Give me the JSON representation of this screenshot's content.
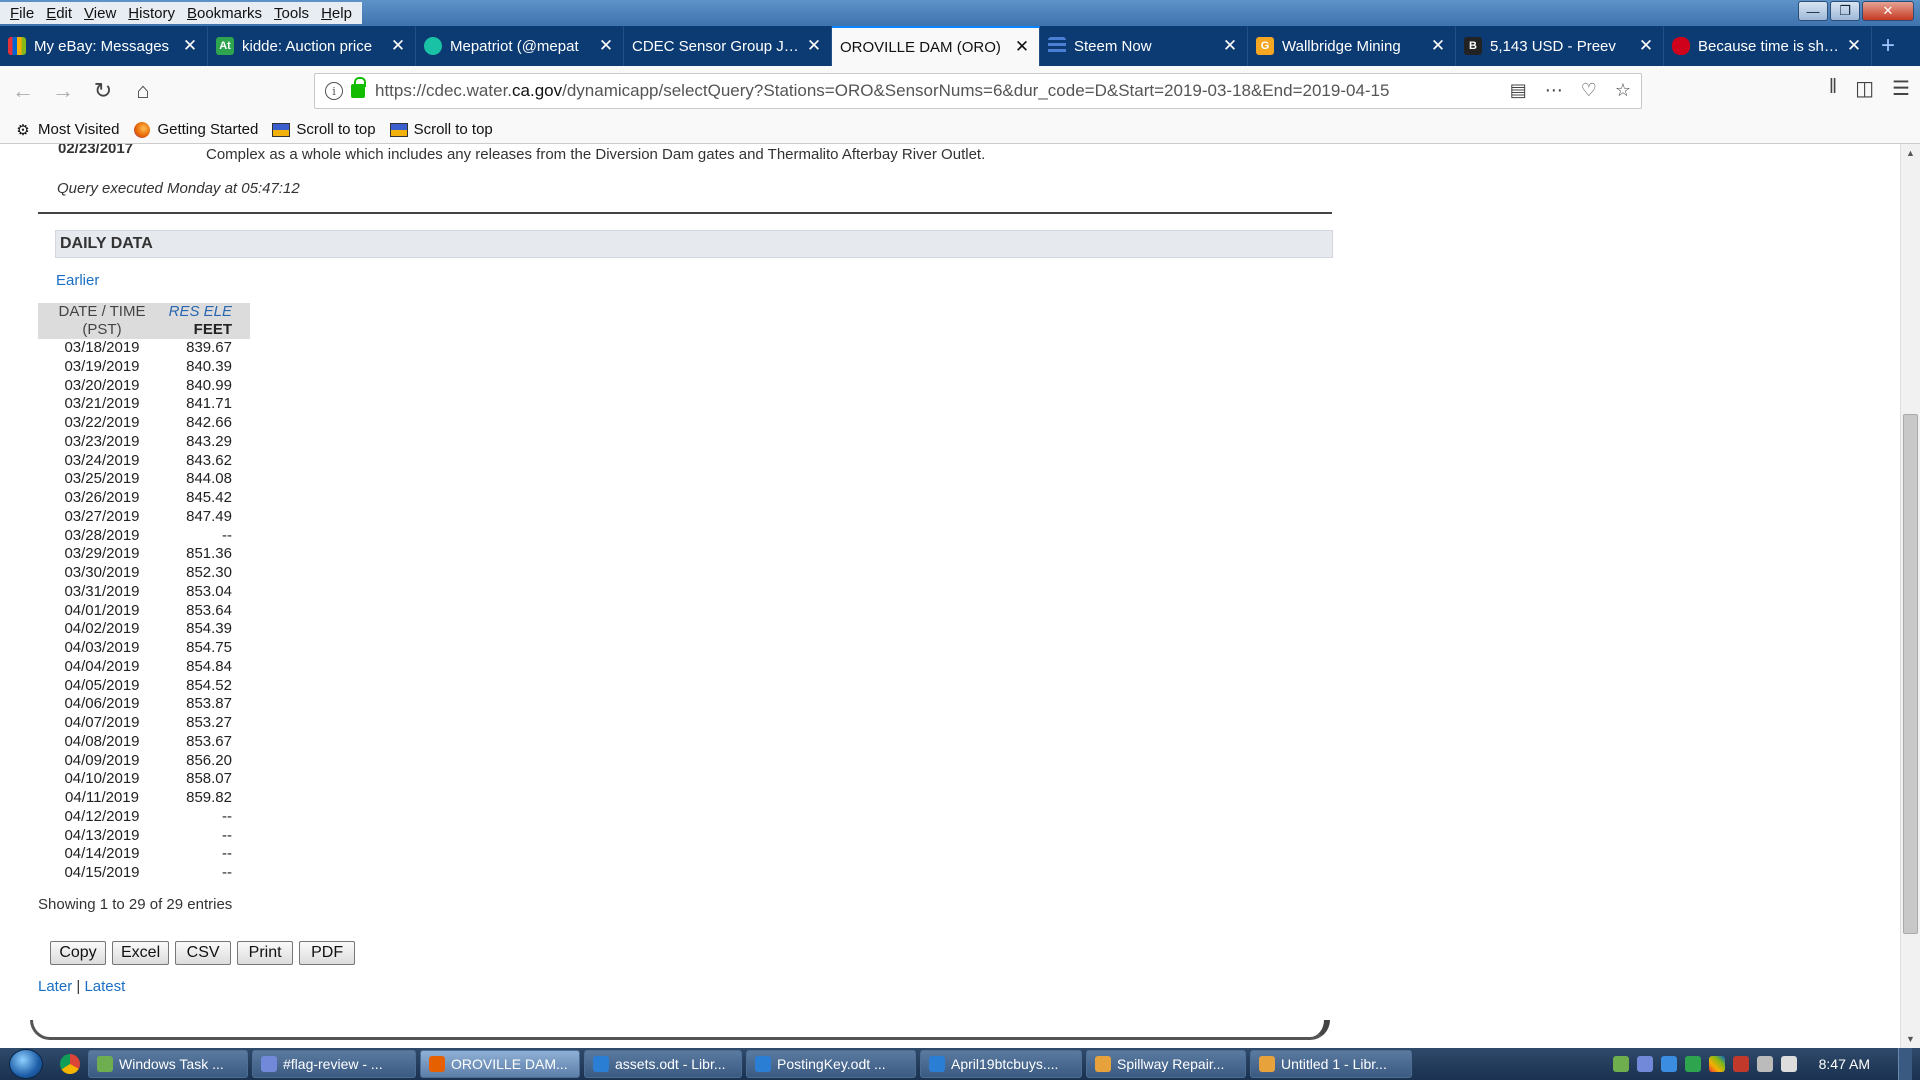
{
  "menubar": {
    "items": [
      "File",
      "Edit",
      "View",
      "History",
      "Bookmarks",
      "Tools",
      "Help"
    ]
  },
  "tabs": [
    {
      "title": "My eBay: Messages",
      "icon": "ebay-icon",
      "color": "#e53238",
      "active": false
    },
    {
      "title": "kidde: Auction price",
      "icon": "auction-icon",
      "color": "#2ea44f",
      "active": false
    },
    {
      "title": "Mepatriot (@mepat",
      "icon": "steem-icon",
      "color": "#19c2a5",
      "active": false
    },
    {
      "title": "CDEC Sensor Group JSON",
      "icon": "page-icon",
      "color": "#3a6fb0",
      "active": false
    },
    {
      "title": "OROVILLE DAM (ORO)",
      "icon": "page-icon",
      "color": "#3a6fb0",
      "active": true
    },
    {
      "title": "Steem Now",
      "icon": "steem-now-icon",
      "color": "#4a7fd4",
      "active": false
    },
    {
      "title": "Wallbridge Mining",
      "icon": "stock-icon",
      "color": "#f5a623",
      "active": false
    },
    {
      "title": "5,143 USD - Preev",
      "icon": "bitcoin-icon",
      "color": "#222222",
      "active": false
    },
    {
      "title": "Because time is short",
      "icon": "microphone-icon",
      "color": "#d0021b",
      "active": false
    }
  ],
  "url": {
    "prefix": "https://cdec.water.",
    "domain": "ca.gov",
    "path": "/dynamicapp/selectQuery?Stations=ORO&SensorNums=6&dur_code=D&Start=2019-03-18&End=2019-04-15"
  },
  "bookmarks": [
    {
      "label": "Most Visited",
      "icon": "gear-icon"
    },
    {
      "label": "Getting Started",
      "icon": "firefox-icon"
    },
    {
      "label": "Scroll to top",
      "icon": "bookmarklet-icon"
    },
    {
      "label": "Scroll to top",
      "icon": "bookmarklet-icon"
    }
  ],
  "page": {
    "note_date": "02/23/2017",
    "note_text": "Complex as a whole which includes any releases from the Diversion Dam gates and Thermalito Afterbay River Outlet.",
    "query_executed": "Query executed Monday at 05:47:12",
    "section_title": "DAILY DATA",
    "earlier_label": "Earlier",
    "table": {
      "col1_header_line1": "DATE / TIME",
      "col1_header_line2": "(PST)",
      "col2_header_line1": "RES ELE",
      "col2_header_line2": "FEET",
      "rows": [
        {
          "date": "03/18/2019",
          "value": "839.67"
        },
        {
          "date": "03/19/2019",
          "value": "840.39"
        },
        {
          "date": "03/20/2019",
          "value": "840.99"
        },
        {
          "date": "03/21/2019",
          "value": "841.71"
        },
        {
          "date": "03/22/2019",
          "value": "842.66"
        },
        {
          "date": "03/23/2019",
          "value": "843.29"
        },
        {
          "date": "03/24/2019",
          "value": "843.62"
        },
        {
          "date": "03/25/2019",
          "value": "844.08"
        },
        {
          "date": "03/26/2019",
          "value": "845.42"
        },
        {
          "date": "03/27/2019",
          "value": "847.49"
        },
        {
          "date": "03/28/2019",
          "value": "--"
        },
        {
          "date": "03/29/2019",
          "value": "851.36"
        },
        {
          "date": "03/30/2019",
          "value": "852.30"
        },
        {
          "date": "03/31/2019",
          "value": "853.04"
        },
        {
          "date": "04/01/2019",
          "value": "853.64"
        },
        {
          "date": "04/02/2019",
          "value": "854.39"
        },
        {
          "date": "04/03/2019",
          "value": "854.75"
        },
        {
          "date": "04/04/2019",
          "value": "854.84"
        },
        {
          "date": "04/05/2019",
          "value": "854.52"
        },
        {
          "date": "04/06/2019",
          "value": "853.87"
        },
        {
          "date": "04/07/2019",
          "value": "853.27"
        },
        {
          "date": "04/08/2019",
          "value": "853.67"
        },
        {
          "date": "04/09/2019",
          "value": "856.20"
        },
        {
          "date": "04/10/2019",
          "value": "858.07"
        },
        {
          "date": "04/11/2019",
          "value": "859.82"
        },
        {
          "date": "04/12/2019",
          "value": "--"
        },
        {
          "date": "04/13/2019",
          "value": "--"
        },
        {
          "date": "04/14/2019",
          "value": "--"
        },
        {
          "date": "04/15/2019",
          "value": "--"
        }
      ]
    },
    "entries_info": "Showing 1 to 29 of 29 entries",
    "buttons": [
      "Copy",
      "Excel",
      "CSV",
      "Print",
      "PDF"
    ],
    "later_label": "Later",
    "separator": "|",
    "latest_label": "Latest"
  },
  "taskbar": {
    "items": [
      {
        "label": "Windows Task ...",
        "icon": "task-manager-icon",
        "color": "#6fae4f",
        "active": false
      },
      {
        "label": "#flag-review - ...",
        "icon": "discord-icon",
        "color": "#7289da",
        "active": false
      },
      {
        "label": "OROVILLE DAM...",
        "icon": "firefox-icon",
        "color": "#e66000",
        "active": true
      },
      {
        "label": "assets.odt - Libr...",
        "icon": "writer-icon",
        "color": "#2a7fd4",
        "active": false
      },
      {
        "label": "PostingKey.odt ...",
        "icon": "writer-icon",
        "color": "#2a7fd4",
        "active": false
      },
      {
        "label": "April19btcbuys....",
        "icon": "writer-icon",
        "color": "#2a7fd4",
        "active": false
      },
      {
        "label": "Spillway Repair...",
        "icon": "impress-icon",
        "color": "#e8a23b",
        "active": false
      },
      {
        "label": "Untitled 1 - Libr...",
        "icon": "impress-icon",
        "color": "#e8a23b",
        "active": false
      }
    ],
    "clock": "8:47 AM"
  }
}
